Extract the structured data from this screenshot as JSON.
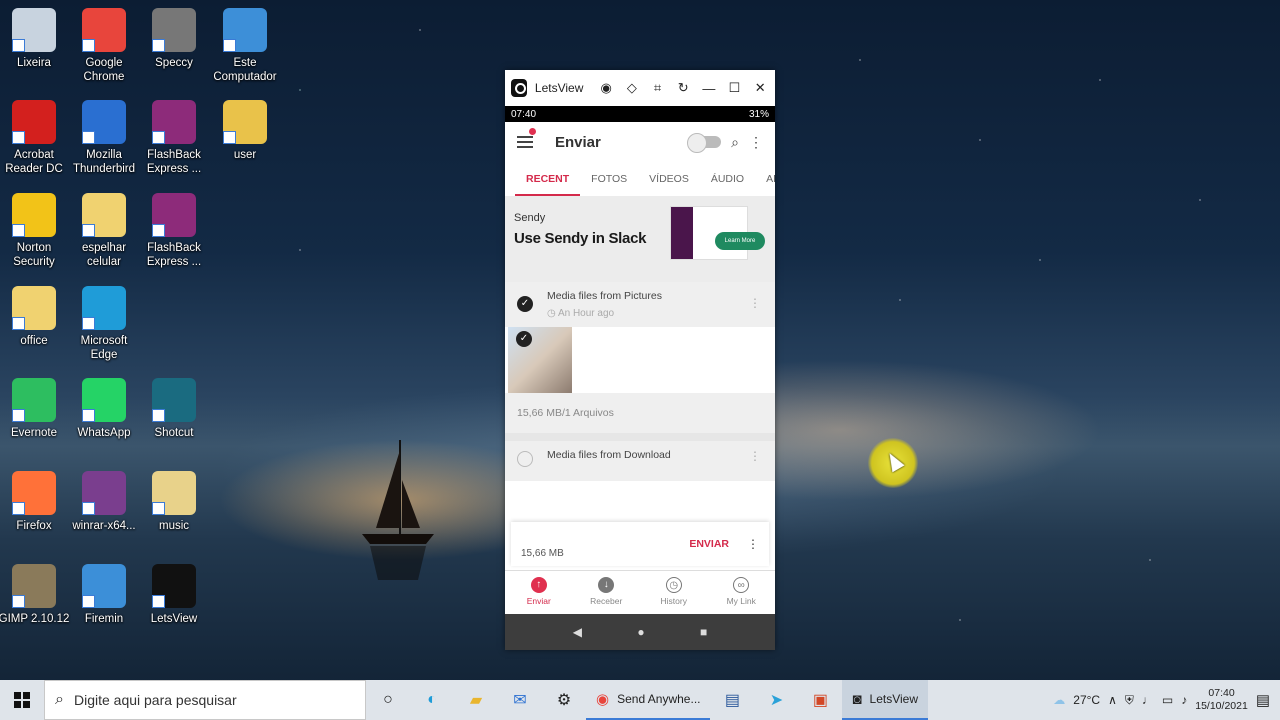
{
  "desktop": {
    "icons": [
      {
        "label": "Lixeira",
        "icon": "recycle-bin-icon",
        "color": "#c8d3df"
      },
      {
        "label": "Google Chrome",
        "icon": "chrome-icon",
        "color": "#e8453c"
      },
      {
        "label": "Speccy",
        "icon": "speccy-icon",
        "color": "#777777"
      },
      {
        "label": "Este Computador",
        "icon": "computer-icon",
        "color": "#3d8fd8"
      },
      {
        "label": "Acrobat Reader DC",
        "icon": "acrobat-icon",
        "color": "#d3201e"
      },
      {
        "label": "Mozilla Thunderbird",
        "icon": "thunderbird-icon",
        "color": "#2a6fd1"
      },
      {
        "label": "FlashBack Express ...",
        "icon": "flashback-icon",
        "color": "#8d2b7a"
      },
      {
        "label": "user",
        "icon": "user-folder-icon",
        "color": "#e9c24a"
      },
      {
        "label": "Norton Security",
        "icon": "norton-icon",
        "color": "#f2c318"
      },
      {
        "label": "espelhar celular",
        "icon": "folder-icon",
        "color": "#f0d270"
      },
      {
        "label": "FlashBack Express ...",
        "icon": "flashback-icon",
        "color": "#8d2b7a"
      },
      {
        "label": "office",
        "icon": "folder-icon",
        "color": "#f0d270"
      },
      {
        "label": "Microsoft Edge",
        "icon": "edge-icon",
        "color": "#1f9cd8"
      },
      {
        "label": "Evernote",
        "icon": "evernote-icon",
        "color": "#2dbe60"
      },
      {
        "label": "WhatsApp",
        "icon": "whatsapp-icon",
        "color": "#25d366"
      },
      {
        "label": "Shotcut",
        "icon": "shotcut-icon",
        "color": "#1a6b80"
      },
      {
        "label": "Firefox",
        "icon": "firefox-icon",
        "color": "#ff7139"
      },
      {
        "label": "winrar-x64...",
        "icon": "winrar-icon",
        "color": "#7a3e8e"
      },
      {
        "label": "music",
        "icon": "music-folder-icon",
        "color": "#e8d28a"
      },
      {
        "label": "GIMP 2.10.12",
        "icon": "gimp-icon",
        "color": "#8a7a5a"
      },
      {
        "label": "Firemin",
        "icon": "firemin-icon",
        "color": "#3c8fd8"
      },
      {
        "label": "LetsView",
        "icon": "letsview-icon",
        "color": "#111111"
      }
    ]
  },
  "letsview": {
    "title": "LetsView",
    "controls": [
      "pen-icon",
      "record-icon",
      "diamond-icon",
      "crop-icon",
      "rotate-icon",
      "minimize-icon",
      "maximize-icon",
      "close-icon"
    ],
    "minimize": "—",
    "maximize": "☐",
    "close": "✕"
  },
  "phone": {
    "status_time": "07:40",
    "status_battery": "31%",
    "app_title": "Enviar",
    "tabs": [
      "RECENT",
      "FOTOS",
      "VÍDEOS",
      "ÁUDIO",
      "APLICAT"
    ],
    "ad": {
      "brand": "Sendy",
      "headline": "Use Sendy in Slack",
      "cta": "Learn More"
    },
    "group1": {
      "title": "Media files from Pictures",
      "time": "An Hour ago",
      "size": "15,66 MB/1 Arquivos"
    },
    "group2": {
      "title": "Media files from Download"
    },
    "sendbar": {
      "size": "15,66 MB",
      "button": "ENVIAR"
    },
    "bottom_nav": [
      "Enviar",
      "Receber",
      "History",
      "My Link"
    ]
  },
  "taskbar": {
    "search_placeholder": "Digite aqui para pesquisar",
    "apps": [
      {
        "label": "Send Anywhe...",
        "icon": "chrome-icon"
      },
      {
        "label": "LetsView",
        "icon": "letsview-icon"
      }
    ],
    "temperature": "27°C",
    "time": "07:40",
    "date": "15/10/2021"
  }
}
